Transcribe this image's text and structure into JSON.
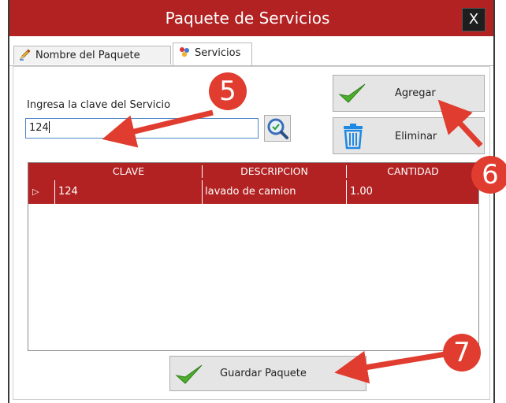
{
  "window": {
    "title": "Paquete de Servicios",
    "close_label": "X"
  },
  "tabs": [
    {
      "label": "Nombre del Paquete",
      "icon": "pencil-icon",
      "active": false
    },
    {
      "label": "Servicios",
      "icon": "services-icon",
      "active": true
    }
  ],
  "form": {
    "clave_label": "Ingresa la clave del Servicio",
    "clave_value": "124"
  },
  "buttons": {
    "add_label": "Agregar",
    "delete_label": "Eliminar",
    "save_label": "Guardar Paquete"
  },
  "grid": {
    "columns": [
      "CLAVE",
      "DESCRIPCION",
      "CANTIDAD"
    ],
    "rows": [
      {
        "clave": "124",
        "descripcion": "lavado de camion",
        "cantidad": "1.00"
      }
    ],
    "row_indicator": "▷"
  },
  "annotations": [
    "5",
    "6",
    "7"
  ],
  "colors": {
    "accent": "#b22222",
    "annotation": "#e03c2f",
    "check": "#4caf2a",
    "trash": "#1e88e5"
  }
}
